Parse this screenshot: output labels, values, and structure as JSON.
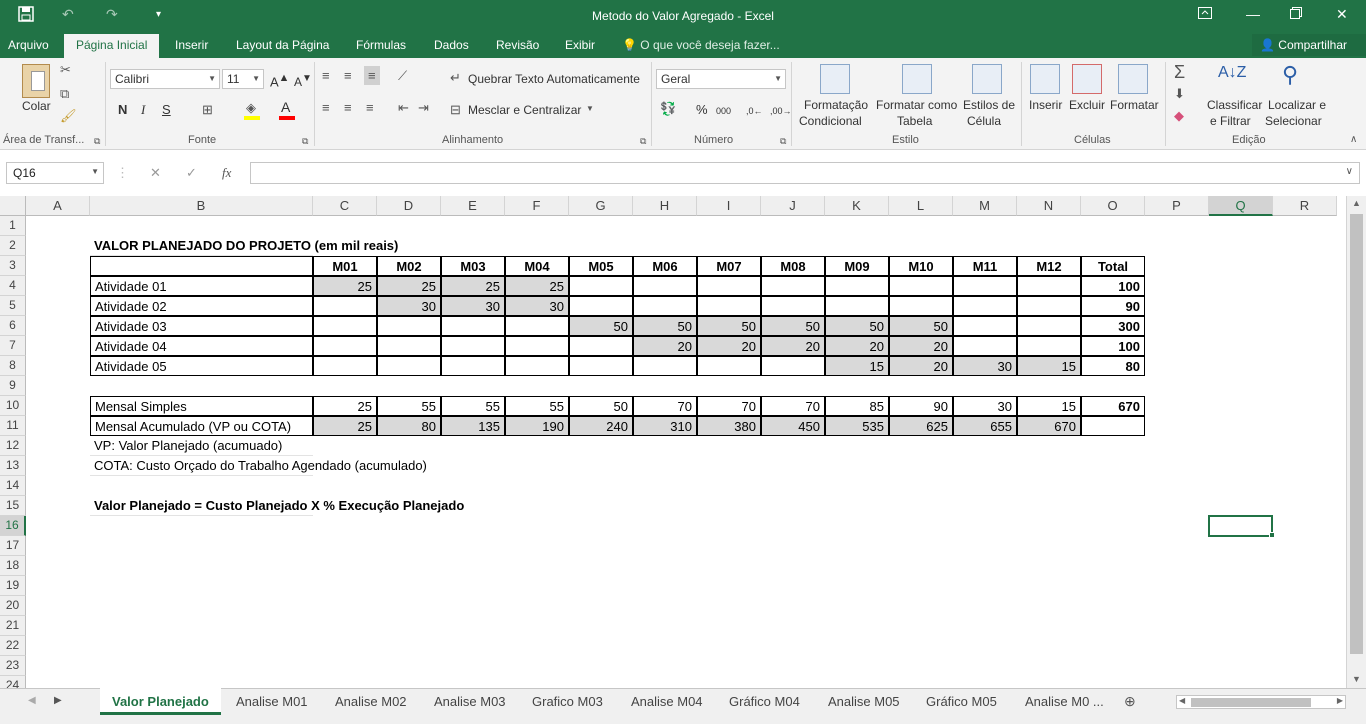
{
  "window": {
    "title": "Metodo do Valor Agregado - Excel",
    "quick_access": [
      "save-icon",
      "undo-icon",
      "redo-icon",
      "customize-icon"
    ],
    "controls": [
      "ribbon-display-icon",
      "minimize-icon",
      "restore-icon",
      "close-icon"
    ]
  },
  "tabs": [
    "Arquivo",
    "Página Inicial",
    "Inserir",
    "Layout da Página",
    "Fórmulas",
    "Dados",
    "Revisão",
    "Exibir"
  ],
  "active_tab": "Página Inicial",
  "tell_me": "O que você deseja fazer...",
  "share_label": "Compartilhar",
  "ribbon": {
    "groups": [
      "Área de Transf...",
      "Fonte",
      "Alinhamento",
      "Número",
      "Estilo",
      "Células",
      "Edição"
    ],
    "paste_label": "Colar",
    "font_name": "Calibri",
    "font_size": "11",
    "wrap_text": "Quebrar Texto Automaticamente",
    "merge_center": "Mesclar e Centralizar",
    "number_format": "Geral",
    "cond_format": [
      "Formatação",
      "Condicional"
    ],
    "format_table": [
      "Formatar como",
      "Tabela"
    ],
    "cell_styles": [
      "Estilos de",
      "Célula"
    ],
    "insert": "Inserir",
    "delete": "Excluir",
    "format": "Formatar",
    "sort_filter": [
      "Classificar",
      "e Filtrar"
    ],
    "find_select": [
      "Localizar e",
      "Selecionar"
    ],
    "font_buttons": [
      "N",
      "I",
      "S"
    ],
    "number_buttons": [
      "%",
      "000",
      ",0←",
      ",00→"
    ]
  },
  "formula_bar": {
    "name_box": "Q16",
    "fx": "fx",
    "formula": ""
  },
  "columns": [
    "A",
    "B",
    "C",
    "D",
    "E",
    "F",
    "G",
    "H",
    "I",
    "J",
    "K",
    "L",
    "M",
    "N",
    "O",
    "P",
    "Q",
    "R"
  ],
  "rows": [
    "1",
    "2",
    "3",
    "4",
    "5",
    "6",
    "7",
    "8",
    "9",
    "10",
    "11",
    "12",
    "13",
    "14",
    "15",
    "16",
    "17",
    "18",
    "19",
    "20",
    "21",
    "22",
    "23",
    "24"
  ],
  "selected_cell": "Q16",
  "sheet": {
    "title": "VALOR PLANEJADO DO PROJETO (em mil reais)",
    "months": [
      "M01",
      "M02",
      "M03",
      "M04",
      "M05",
      "M06",
      "M07",
      "M08",
      "M09",
      "M10",
      "M11",
      "M12"
    ],
    "total_header": "Total",
    "activities": [
      {
        "name": "Atividade 01",
        "values": [
          "25",
          "25",
          "25",
          "25",
          "",
          "",
          "",
          "",
          "",
          "",
          "",
          ""
        ],
        "total": "100"
      },
      {
        "name": "Atividade 02",
        "values": [
          "",
          "30",
          "30",
          "30",
          "",
          "",
          "",
          "",
          "",
          "",
          "",
          ""
        ],
        "total": "90"
      },
      {
        "name": "Atividade 03",
        "values": [
          "",
          "",
          "",
          "",
          "50",
          "50",
          "50",
          "50",
          "50",
          "50",
          "",
          ""
        ],
        "total": "300"
      },
      {
        "name": "Atividade 04",
        "values": [
          "",
          "",
          "",
          "",
          "",
          "20",
          "20",
          "20",
          "20",
          "20",
          "",
          ""
        ],
        "total": "100"
      },
      {
        "name": "Atividade 05",
        "values": [
          "",
          "",
          "",
          "",
          "",
          "",
          "",
          "",
          "15",
          "20",
          "30",
          "15"
        ],
        "total": "80"
      }
    ],
    "monthly_simple": {
      "label": "Mensal Simples",
      "values": [
        "25",
        "55",
        "55",
        "55",
        "50",
        "70",
        "70",
        "70",
        "85",
        "90",
        "30",
        "15"
      ],
      "total": "670"
    },
    "monthly_cumulative": {
      "label": "Mensal Acumulado (VP ou COTA)",
      "values": [
        "25",
        "80",
        "135",
        "190",
        "240",
        "310",
        "380",
        "450",
        "535",
        "625",
        "655",
        "670"
      ],
      "total": ""
    },
    "note_vp": "VP: Valor Planejado (acumuado)",
    "note_cota": "COTA: Custo Orçado do Trabalho Agendado (acumulado)",
    "formula_note": "Valor Planejado = Custo Planejado X % Execução Planejado"
  },
  "sheet_tabs": [
    "Valor Planejado",
    "Analise M01",
    "Analise M02",
    "Analise M03",
    "Grafico M03",
    "Analise M04",
    "Gráfico M04",
    "Analise M05",
    "Gráfico M05",
    "Analise M0 ..."
  ],
  "active_sheet_tab": "Valor Planejado"
}
